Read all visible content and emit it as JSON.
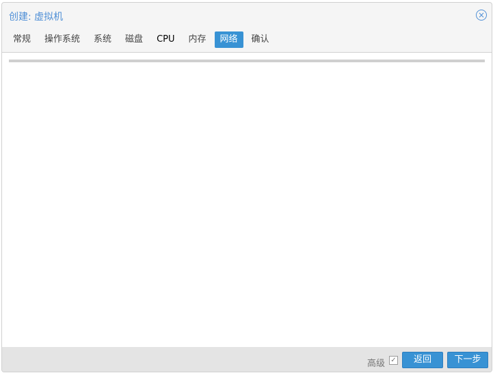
{
  "dialog": {
    "title": "创建: 虚拟机",
    "tabs": [
      "常规",
      "操作系统",
      "系统",
      "磁盘",
      "CPU",
      "内存",
      "网络",
      "确认"
    ],
    "active_tab": "网络"
  },
  "footer": {
    "advanced_label": "高级",
    "advanced_checked": true,
    "back_label": "返回",
    "next_label": "下一步"
  }
}
